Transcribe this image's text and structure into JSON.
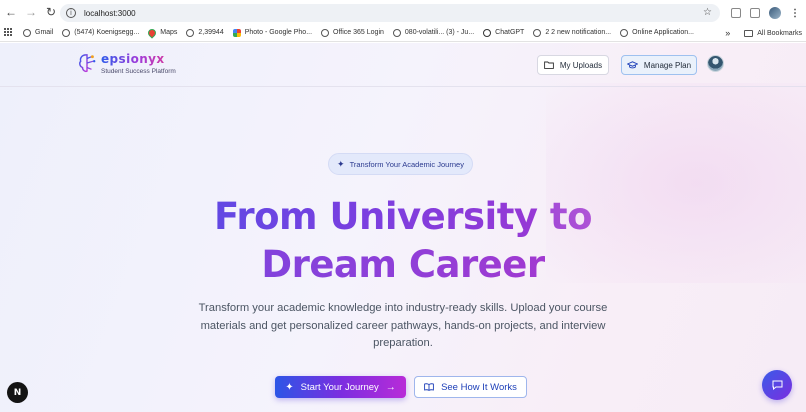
{
  "browser": {
    "url": "localhost:3000",
    "bookmarks": [
      {
        "label": "Gmail",
        "icon": "globe-icon"
      },
      {
        "label": "(5474) Koenigsegg...",
        "icon": "globe-icon"
      },
      {
        "label": "Maps",
        "icon": "maps-icon"
      },
      {
        "label": "2,39944",
        "icon": "globe-icon"
      },
      {
        "label": "Photo - Google Pho...",
        "icon": "google-photos-icon"
      },
      {
        "label": "Office 365 Login",
        "icon": "globe-icon"
      },
      {
        "label": "080-volatili... (3) - Ju...",
        "icon": "globe-icon"
      },
      {
        "label": "ChatGPT",
        "icon": "chatgpt-icon"
      },
      {
        "label": "2 2 new notification...",
        "icon": "globe-icon"
      },
      {
        "label": "Online Application...",
        "icon": "globe-icon"
      }
    ],
    "overflow_label": "»",
    "all_bookmarks_label": "All Bookmarks"
  },
  "header": {
    "brand": "epsionyx",
    "tagline": "Student Success Platform",
    "uploads_label": "My Uploads",
    "manage_plan_label": "Manage Plan"
  },
  "hero": {
    "pill_label": "Transform Your Academic Journey",
    "title_line1": "From University to",
    "title_line2": "Dream Career",
    "subtitle": "Transform your academic knowledge into industry-ready skills. Upload your course materials and get personalized career pathways, hands-on projects, and interview preparation.",
    "primary_cta": "Start Your Journey",
    "secondary_cta": "See How It Works"
  },
  "misc": {
    "next_badge": "N"
  },
  "colors": {
    "brand_blue": "#2c55e6",
    "brand_purple": "#7b2ee0",
    "brand_pink": "#c22fc3"
  }
}
